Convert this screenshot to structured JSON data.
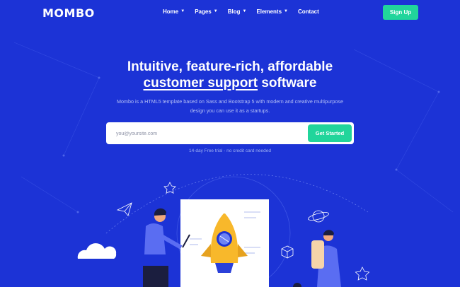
{
  "brand": {
    "logo": "MOMBO"
  },
  "nav": {
    "items": [
      {
        "label": "Home",
        "has_dropdown": true
      },
      {
        "label": "Pages",
        "has_dropdown": true
      },
      {
        "label": "Blog",
        "has_dropdown": true
      },
      {
        "label": "Elements",
        "has_dropdown": true
      },
      {
        "label": "Contact",
        "has_dropdown": false
      }
    ],
    "signup_label": "Sign Up"
  },
  "hero": {
    "title_line1": "Intuitive, feature-rich, affordable",
    "title_underlined": "customer support",
    "title_tail": "software",
    "subtitle": "Mombo is a HTML5 template based on Sass and Bootstrap 5 with modern and creative multipurpose design you can use it as a startups.",
    "email_placeholder": "you@yoursite.com",
    "cta_label": "Get Started",
    "trial_note": "14-day Free trial - no credit card needed"
  },
  "colors": {
    "background": "#1c33d6",
    "accent": "#21d59b",
    "rocket": "#f8b82b"
  }
}
